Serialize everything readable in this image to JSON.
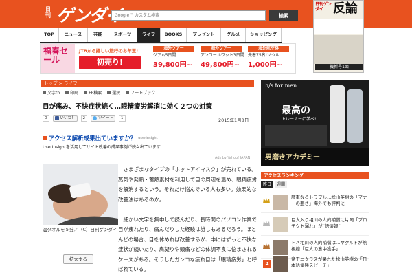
{
  "header": {
    "logo_small": "日刊",
    "logo": "ゲンダイ",
    "search_placeholder": "Google™ カスタム検索",
    "search_button": "検索"
  },
  "nav": {
    "items": [
      {
        "label": "TOP",
        "active": false
      },
      {
        "label": "ニュース",
        "active": false
      },
      {
        "label": "芸能",
        "active": false
      },
      {
        "label": "スポーツ",
        "active": false
      },
      {
        "label": "ライフ",
        "active": true
      },
      {
        "label": "BOOKS",
        "active": false
      },
      {
        "label": "プレゼント",
        "active": false
      },
      {
        "label": "グルメ",
        "active": false
      },
      {
        "label": "ショッピング",
        "active": false
      }
    ]
  },
  "magazine_ad": {
    "title": "反論",
    "sub": "日刊ゲンダイ",
    "date": "機新号1面"
  },
  "banner": {
    "left_text": "福春セール",
    "jtb": "JTBから嬉しい旅行のお年玉!",
    "sale": "初売り!",
    "deals": [
      {
        "tag": "海外ツアー",
        "desc": "グアム5日間",
        "price": "39,800円~"
      },
      {
        "tag": "海外ツアー",
        "desc": "アンコールワット3日間",
        "price": "49,800円~"
      },
      {
        "tag": "海外航空券",
        "desc": "先着75名!ソウル",
        "price": "1,000円~"
      }
    ]
  },
  "breadcrumb": "トップ > ライフ",
  "toolbar": {
    "items": [
      "文字tb",
      "印刷",
      "FP検索",
      "選択",
      "ノートブック"
    ]
  },
  "article": {
    "headline": "目が痛み、不快症状続く…眼精疲労解消に効く２つの対策",
    "date": "2015年1月8日",
    "share": {
      "fb_count": "0",
      "fb_label": "いいね！",
      "gplus": "2",
      "tweet_label": "ツイート",
      "tweet_count": "1"
    },
    "access_ad": {
      "title": "アクセス解析成果出ていますか？",
      "source": "userinsight",
      "desc": "UserInsightを活用してサイト改善の成果事例が続々出ています"
    },
    "adby": "Ads by Yahoo! JAPAN",
    "caption": "温タオルを５分／（C）日刊ゲンダイ",
    "enlarge": "拡大する",
    "paragraphs": [
      "さまざまなタイプの「ホットアイマスク」が売れている。蒸気や発熱・蓄熱素材を利用して目の周辺を温め、眼精疲労を解消するという。それだけ悩んでいる人も多い。効果的な改善法はあるのか。",
      "細かい文字を集中して読んだり、長時間のパソコン作業で目が疲れたり、痛んだりした経験は誰しもあるだろう。ほとんどの場合、目を休めれば改善するが、中にはずっと不快な症状が続いたり、肩凝りや頭痛などの体調不良に悩まされるケースがある。そうしたガンコな疲れ目は「眼精疲労」と呼ばれている。"
    ]
  },
  "side_ad": {
    "brand": "h/s for men",
    "catch": "最高の",
    "catch2": "トレーナーに学べ!",
    "bottom": "男磨きアカデミー"
  },
  "ranking": {
    "title": "アクセスランキング",
    "tabs": [
      {
        "label": "昨日",
        "active": true
      },
      {
        "label": "週間",
        "active": false
      }
    ],
    "items": [
      {
        "rank": "1",
        "title": "度重なるトラブル…松山英樹の「マナーの悪さ」海外でも評判に"
      },
      {
        "rank": "2",
        "title": "巨人入り相川の人的補償に片岡「プロテクト漏れ」が“悟懐報”"
      },
      {
        "rank": "3",
        "title": "ＦＡ相川の人的補償は…ヤクルトが熱視線「巨人の意中投手」"
      },
      {
        "rank": "4",
        "title": "帝王ニクラスが呆れた松山英樹の「日本語優勝スピーチ」"
      }
    ]
  },
  "colors": {
    "brand": "#e8521f",
    "dark": "#222222"
  }
}
